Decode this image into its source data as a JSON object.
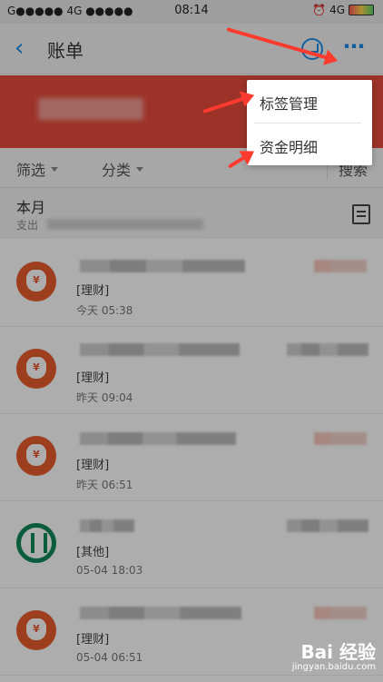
{
  "status_bar": {
    "left": "G●●●●● 4G ●●●●●",
    "time": "08:14",
    "right_network": "4G"
  },
  "nav": {
    "back_icon": "chevron-left-icon",
    "title": "账单",
    "clock_icon": "clock-icon",
    "more_icon": "more-icon"
  },
  "filters": {
    "filter_label": "筛选",
    "category_label": "分类",
    "search_label": "搜索"
  },
  "month": {
    "title": "本月",
    "expense_prefix": "支出"
  },
  "transactions": [
    {
      "category": "[理财]",
      "time": "今天  05:38",
      "icon": "money-bag-icon"
    },
    {
      "category": "[理财]",
      "time": "昨天  09:04",
      "icon": "money-bag-icon"
    },
    {
      "category": "[理财]",
      "time": "昨天  06:51",
      "icon": "money-bag-icon"
    },
    {
      "category": "[其他]",
      "time": "05-04  18:03",
      "icon": "bank-logo-icon"
    },
    {
      "category": "[理财]",
      "time": "05-04  06:51",
      "icon": "money-bag-icon"
    }
  ],
  "popup_menu": {
    "items": [
      "标签管理",
      "资金明细"
    ]
  },
  "watermark": {
    "brand": "Bai 经验",
    "url": "jingyan.baidu.com"
  },
  "colors": {
    "accent_blue": "#1f8ee6",
    "banner_red": "#e64a3b",
    "icon_orange": "#e75c2f",
    "arrow_red": "#ff3a2f"
  }
}
